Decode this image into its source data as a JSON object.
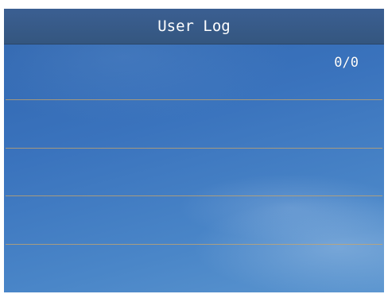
{
  "header": {
    "title": "User Log"
  },
  "log": {
    "counter": "0/0",
    "entries": [
      "",
      "",
      "",
      ""
    ]
  },
  "colors": {
    "header_background": "#34567f",
    "screen_background": "#3a73bd",
    "divider": "#c9a56a",
    "text": "#ffffff"
  }
}
